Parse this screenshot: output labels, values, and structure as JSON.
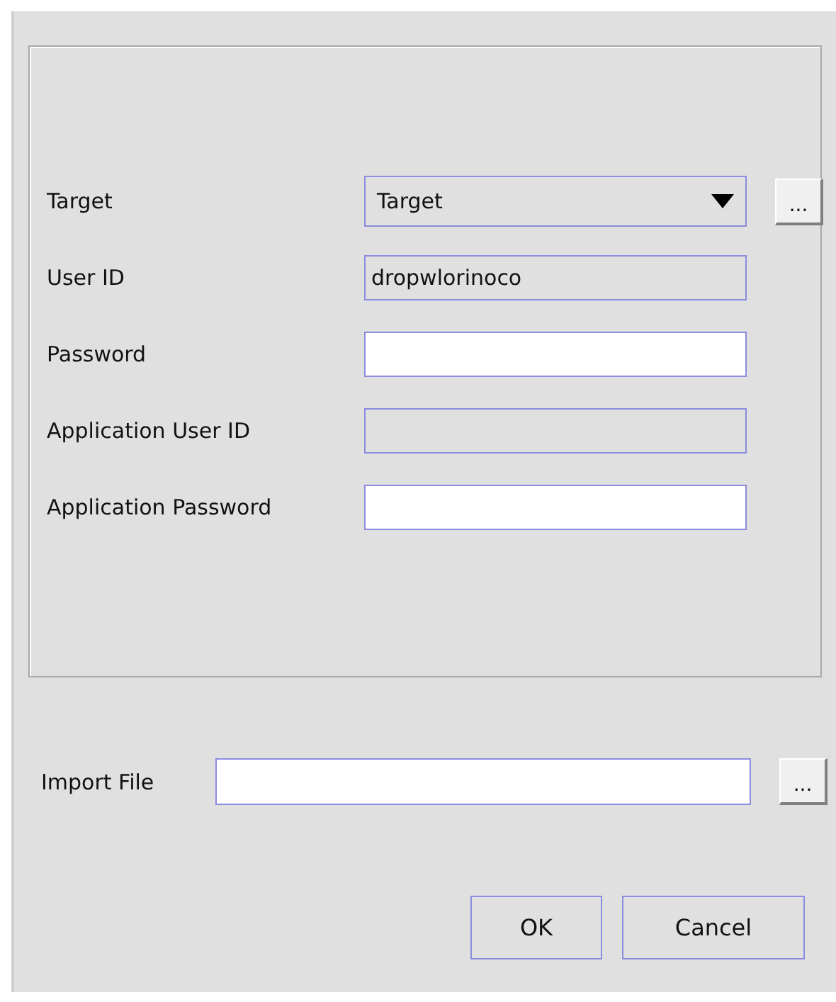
{
  "panel": {
    "fields": [
      {
        "kind": "dropdown",
        "label": "Target",
        "value": "Target",
        "browse": "..."
      },
      {
        "kind": "text",
        "label": "User ID",
        "value": "dropwlorinoco",
        "disabled": true
      },
      {
        "kind": "text",
        "label": "Password",
        "disabled": false
      },
      {
        "kind": "text",
        "label": "Application User ID",
        "disabled": true
      },
      {
        "kind": "text",
        "label": "Application Password",
        "disabled": false
      }
    ]
  },
  "import_file": {
    "label": "Import File",
    "browse": "..."
  },
  "buttons": [
    "OK",
    "Cancel"
  ]
}
